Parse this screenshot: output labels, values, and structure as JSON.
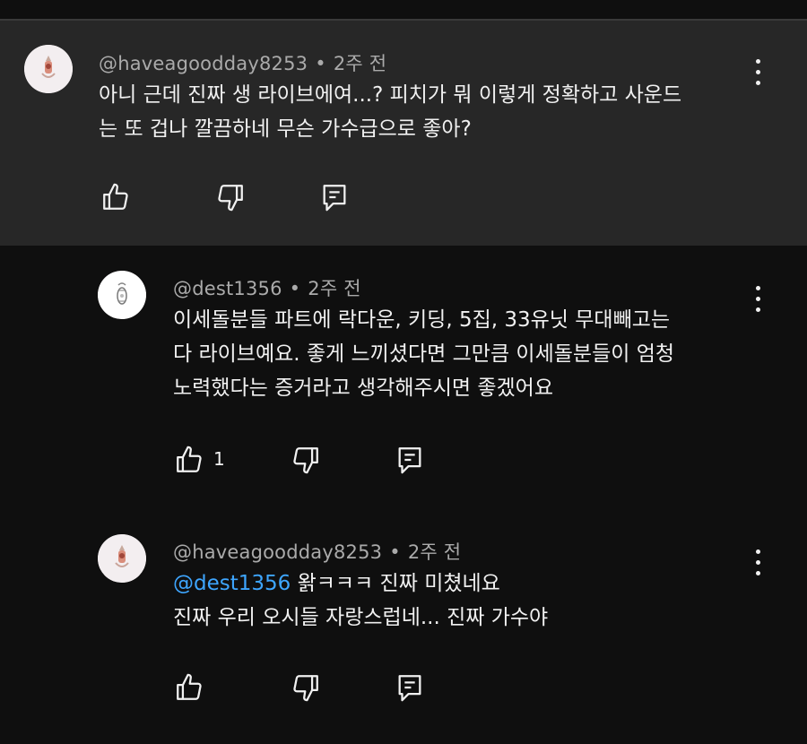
{
  "comments": [
    {
      "author": "@haveagoodday8253",
      "time": "2주 전",
      "lines": [
        "아니 근데 진짜 생 라이브에여...? 피치가 뭐 이렇게 정확하고 사운드",
        "는 또 겁나 깔끔하네 무슨 가수급으로 좋아?"
      ],
      "likes": ""
    },
    {
      "author": "@dest1356",
      "time": "2주 전",
      "lines": [
        "이세돌분들 파트에 락다운, 키딩, 5집, 33유닛 무대빼고는",
        "다 라이브예요. 좋게 느끼셨다면 그만큼 이세돌분들이 엄청",
        "노력했다는 증거라고 생각해주시면 좋겠어요"
      ],
      "likes": "1"
    },
    {
      "author": "@haveagoodday8253",
      "time": "2주 전",
      "mention": "@dest1356",
      "lines": [
        " 왉ㅋㅋㅋ 진짜 미쳤네요",
        "진짜 우리 오시들 자랑스럽네... 진짜 가수야"
      ],
      "likes": ""
    }
  ],
  "icons": {
    "like": "thumbs-up-icon",
    "dislike": "thumbs-down-icon",
    "reply": "reply-comment-icon",
    "menu": "more-vert-icon"
  },
  "colors": {
    "highlight_bg": "#272727",
    "page_bg": "#0f0f0f",
    "mention": "#3ea6ff",
    "meta": "#aaaaaa"
  }
}
